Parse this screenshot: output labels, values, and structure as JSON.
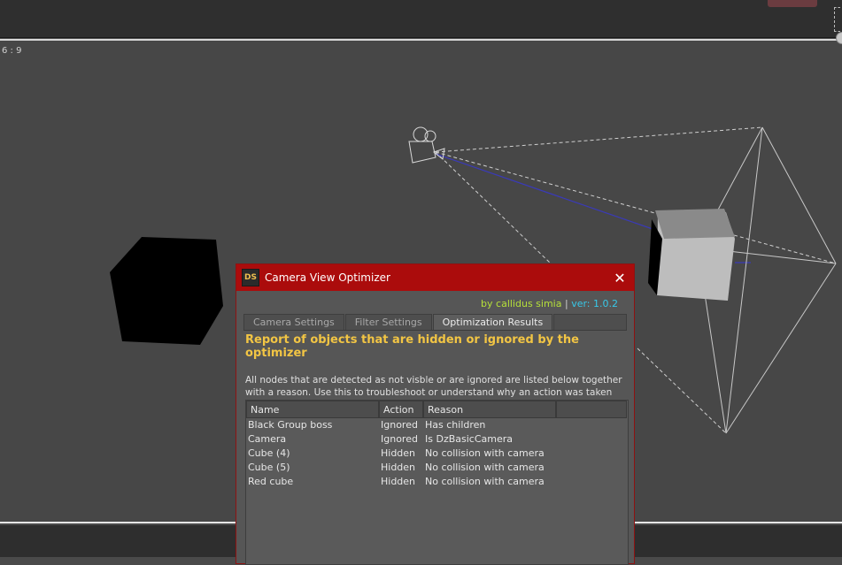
{
  "viewport": {
    "aspect_label": "6 : 9"
  },
  "dialog": {
    "logo": "DS",
    "title": "Camera View Optimizer",
    "credit_by": "by callidus simia",
    "credit_sep": " | ",
    "credit_version": "ver: 1.0.2",
    "tabs": [
      {
        "label": "Camera Settings"
      },
      {
        "label": "Filter Settings"
      },
      {
        "label": "Optimization Results"
      }
    ],
    "active_tab": "Optimization Results",
    "report_title": "Report of objects that are hidden or ignored by the optimizer",
    "report_description": "All nodes that are detected as not visble or are ignored are listed below together with a reason. Use this to troubleshoot or understand why an action was taken on a node.",
    "table": {
      "columns": [
        "Name",
        "Action",
        "Reason",
        ""
      ],
      "rows": [
        {
          "name": "Black Group boss",
          "action": "Ignored",
          "reason": "Has children"
        },
        {
          "name": "Camera",
          "action": "Ignored",
          "reason": "Is DzBasicCamera"
        },
        {
          "name": "Cube (4)",
          "action": "Hidden",
          "reason": "No collision with camera"
        },
        {
          "name": "Cube (5)",
          "action": "Hidden",
          "reason": "No collision with camera"
        },
        {
          "name": "Red cube",
          "action": "Hidden",
          "reason": "No collision with camera"
        }
      ]
    }
  },
  "colors": {
    "titlebar": "#ab0c0c",
    "report_title": "#f2c544",
    "credit_by": "#b6e03a",
    "credit_version": "#38c8e8"
  }
}
